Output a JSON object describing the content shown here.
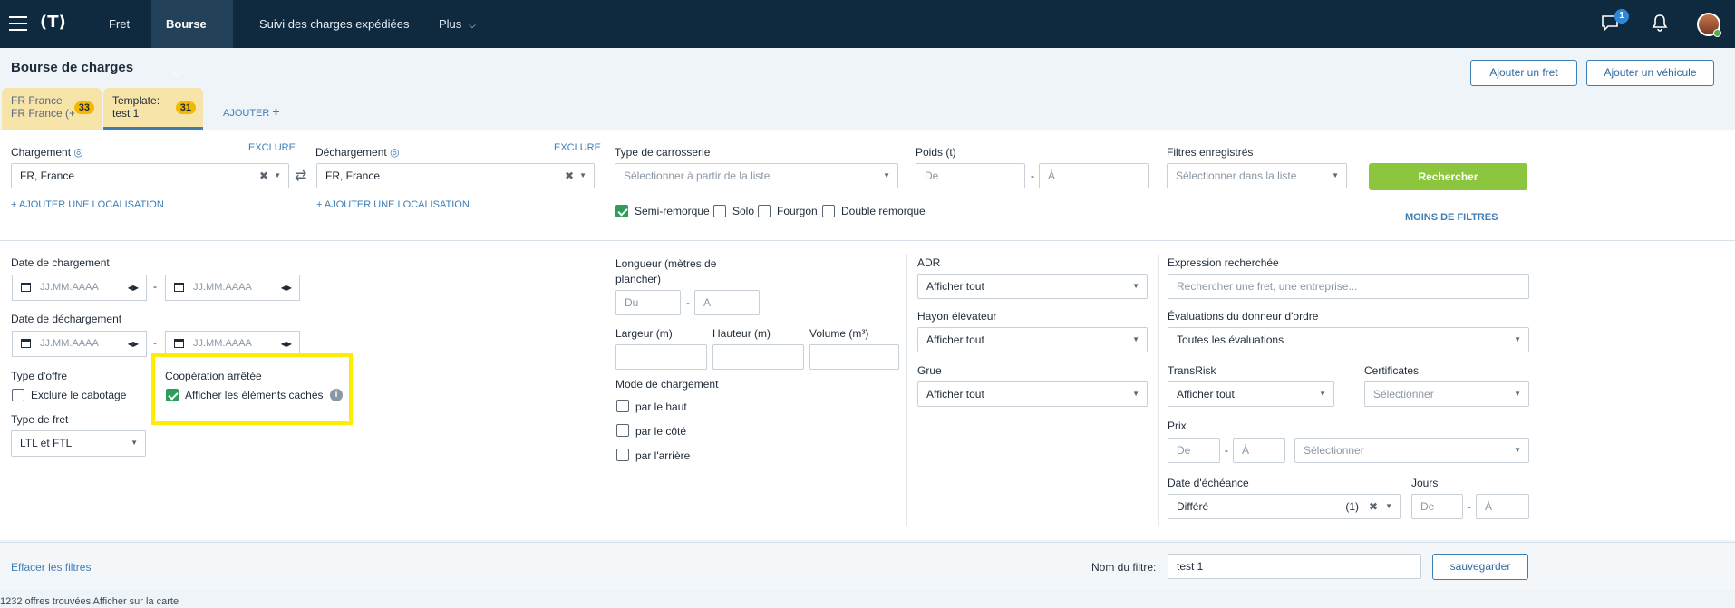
{
  "nav": {
    "fret": "Fret",
    "bourse": "Bourse",
    "suivi": "Suivi des charges expédiées",
    "plus": "Plus",
    "messages_badge": "1"
  },
  "page": {
    "title": "Bourse de charges",
    "add_freight": "Ajouter un fret",
    "add_vehicle": "Ajouter un véhicule"
  },
  "tabs": [
    {
      "line1": "FR France",
      "line2": "FR France (+",
      "count": "33"
    },
    {
      "line1": "Template:",
      "line2": "test 1",
      "count": "31"
    }
  ],
  "tabs_add": "AJOUTER",
  "filters": {
    "chargement_label": "Chargement",
    "dechargement_label": "Déchargement",
    "exclure": "EXCLURE",
    "chargement_value": "FR,  France",
    "dechargement_value": "FR,  France",
    "add_location": "+ AJOUTER UNE LOCALISATION",
    "carrosserie_label": "Type de carrosserie",
    "carrosserie_ph": "Sélectionner à partir de la liste",
    "body_types": [
      "Semi-remorque",
      "Solo",
      "Fourgon",
      "Double remorque"
    ],
    "poids_label": "Poids (t)",
    "de": "De",
    "a": "À",
    "saved_label": "Filtres enregistrés",
    "saved_ph": "Sélectionner dans la liste",
    "search_btn": "Rechercher",
    "less_filters": "MOINS DE FILTRES"
  },
  "advanced": {
    "date_charg": "Date de chargement",
    "date_decharg": "Date de déchargement",
    "date_ph": "JJ.MM.AAAA",
    "offer_type": "Type d'offre",
    "exclude_cabotage": "Exclure le cabotage",
    "coop_stopped": "Coopération arrêtée",
    "show_hidden": "Afficher les éléments cachés",
    "freight_type": "Type de fret",
    "freight_value": "LTL et FTL",
    "longueur": "Longueur (mètres de plancher)",
    "du": "Du",
    "a_plain": "A",
    "largeur": "Largeur (m)",
    "hauteur": "Hauteur (m)",
    "volume": "Volume (m³)",
    "mode_charg": "Mode de chargement",
    "modes": [
      "par le haut",
      "par le côté",
      "par l'arrière"
    ],
    "adr": "ADR",
    "show_all": "Afficher tout",
    "hayon": "Hayon élévateur",
    "grue": "Grue",
    "expr": "Expression recherchée",
    "expr_ph": "Rechercher une fret, une entreprise...",
    "eval": "Évaluations du donneur d'ordre",
    "eval_value": "Toutes les évaluations",
    "transrisk": "TransRisk",
    "certificates": "Certificates",
    "select_ph": "Sélectionner",
    "prix": "Prix",
    "echeance": "Date d'échéance",
    "jours": "Jours",
    "echeance_value": "Différé",
    "echeance_count": "(1)"
  },
  "footer": {
    "clear": "Effacer les filtres",
    "filter_name_label": "Nom du filtre:",
    "filter_name_value": "test 1",
    "save": "sauvegarder"
  },
  "results": "1232 offres trouvées  Afficher sur la carte"
}
